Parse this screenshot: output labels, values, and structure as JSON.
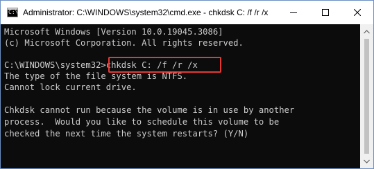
{
  "window": {
    "title": "Administrator: C:\\WINDOWS\\system32\\cmd.exe - chkdsk  C: /f /r /x",
    "icon_text": "C:\\",
    "buttons": [
      "minimize-icon",
      "maximize-icon",
      "close-icon"
    ]
  },
  "console": {
    "lines": [
      "Microsoft Windows [Version 10.0.19045.3086]",
      "(c) Microsoft Corporation. All rights reserved.",
      "",
      "C:\\WINDOWS\\system32>chkdsk C: /f /r /x",
      "The type of the file system is NTFS.",
      "Cannot lock current drive.",
      "",
      "Chkdsk cannot run because the volume is in use by another",
      "process.  Would you like to schedule this volume to be",
      "checked the next time the system restarts? (Y/N)"
    ]
  },
  "colors": {
    "console_bg": "#0c0c0c",
    "console_text": "#cccccc",
    "highlight": "#e53935"
  }
}
